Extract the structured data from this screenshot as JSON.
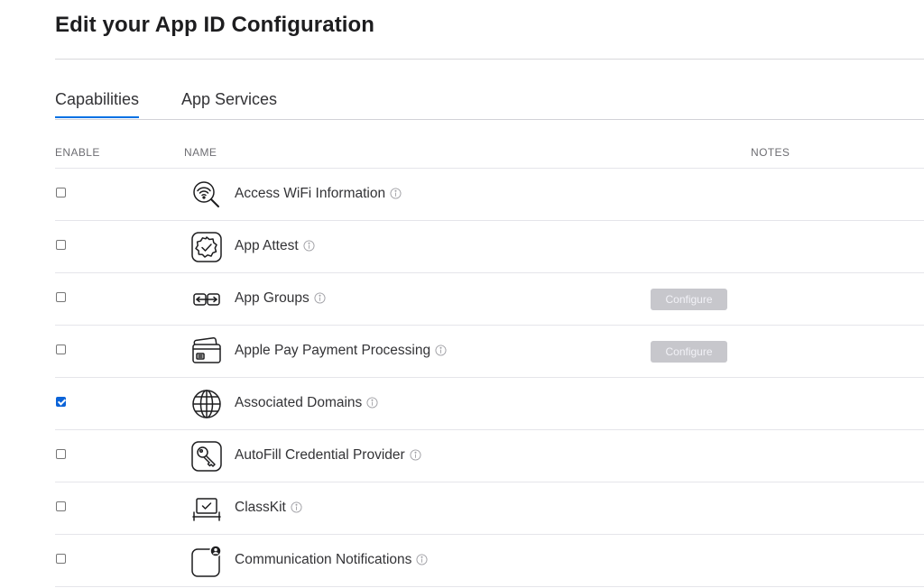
{
  "page": {
    "title": "Edit your App ID Configuration"
  },
  "tabs": [
    {
      "label": "Capabilities",
      "active": true
    },
    {
      "label": "App Services",
      "active": false
    }
  ],
  "columns": {
    "enable": "ENABLE",
    "name": "NAME",
    "notes": "NOTES"
  },
  "colors": {
    "accent": "#0071e3",
    "checkbox": "#0b63d8",
    "disabled_button": "#c7c7cc"
  },
  "capabilities": [
    {
      "name": "Access WiFi Information",
      "icon": "wifi-search-icon",
      "enabled": false
    },
    {
      "name": "App Attest",
      "icon": "badge-check-icon",
      "enabled": false
    },
    {
      "name": "App Groups",
      "icon": "app-groups-icon",
      "enabled": false,
      "configure_label": "Configure"
    },
    {
      "name": "Apple Pay Payment Processing",
      "icon": "credit-card-icon",
      "enabled": false,
      "configure_label": "Configure"
    },
    {
      "name": "Associated Domains",
      "icon": "globe-icon",
      "enabled": true
    },
    {
      "name": "AutoFill Credential Provider",
      "icon": "key-icon",
      "enabled": false
    },
    {
      "name": "ClassKit",
      "icon": "classkit-icon",
      "enabled": false
    },
    {
      "name": "Communication Notifications",
      "icon": "notification-badge-icon",
      "enabled": false
    }
  ]
}
